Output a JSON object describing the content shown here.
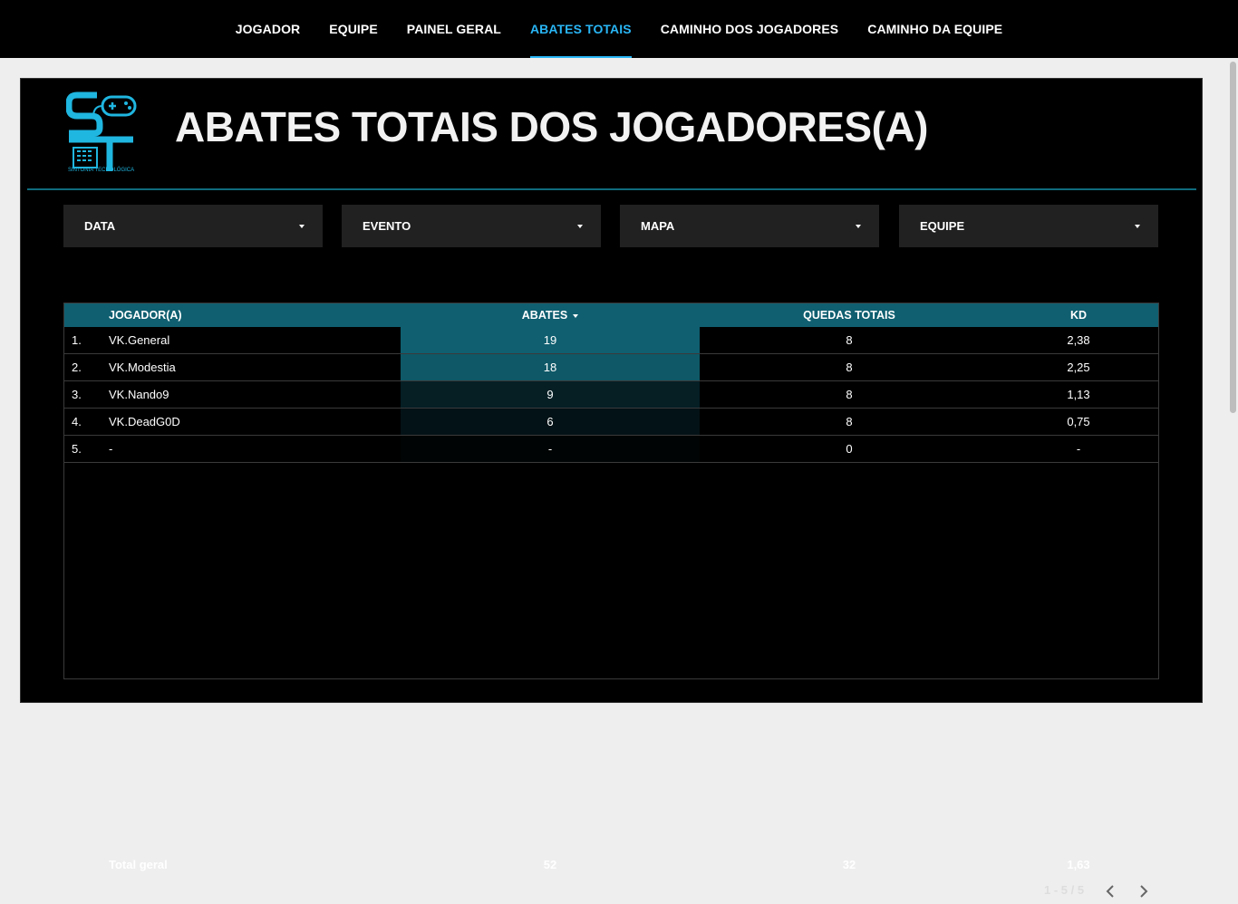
{
  "nav": {
    "tabs": [
      {
        "label": "JOGADOR",
        "active": false
      },
      {
        "label": "EQUIPE",
        "active": false
      },
      {
        "label": "PAINEL GERAL",
        "active": false
      },
      {
        "label": "ABATES TOTAIS",
        "active": true
      },
      {
        "label": "CAMINHO DOS JOGADORES",
        "active": false
      },
      {
        "label": "CAMINHO DA EQUIPE",
        "active": false
      }
    ]
  },
  "header": {
    "title": "ABATES TOTAIS DOS JOGADORES(A)",
    "logo_text": "SINTONIA TECNOLÓGICA",
    "logo_icon": "st-gamepad-logo"
  },
  "filters": [
    {
      "label": "DATA"
    },
    {
      "label": "EVENTO"
    },
    {
      "label": "MAPA"
    },
    {
      "label": "EQUIPE"
    }
  ],
  "table": {
    "columns": {
      "player": "JOGADOR(A)",
      "kills": "ABATES",
      "deaths": "QUEDAS TOTAIS",
      "kd": "KD"
    },
    "sorted_by": "ABATES",
    "rows": [
      {
        "rank": "1.",
        "player": "VK.General",
        "kills": "19",
        "deaths": "8",
        "kd": "2,38"
      },
      {
        "rank": "2.",
        "player": "VK.Modestia",
        "kills": "18",
        "deaths": "8",
        "kd": "2,25"
      },
      {
        "rank": "3.",
        "player": "VK.Nando9",
        "kills": "9",
        "deaths": "8",
        "kd": "1,13"
      },
      {
        "rank": "4.",
        "player": "VK.DeadG0D",
        "kills": "6",
        "deaths": "8",
        "kd": "0,75"
      },
      {
        "rank": "5.",
        "player": "-",
        "kills": "-",
        "deaths": "0",
        "kd": "-"
      }
    ],
    "kill_values": [
      19,
      18,
      9,
      6,
      0
    ],
    "totals": {
      "label": "Total geral",
      "kills": "52",
      "deaths": "32",
      "kd": "1,63"
    },
    "pagination": "1 - 5 / 5"
  },
  "colors": {
    "accent": "#29b6f6",
    "header_bg": "#0f5f70",
    "heat": "#0f5f70",
    "canvas": "#000000"
  }
}
